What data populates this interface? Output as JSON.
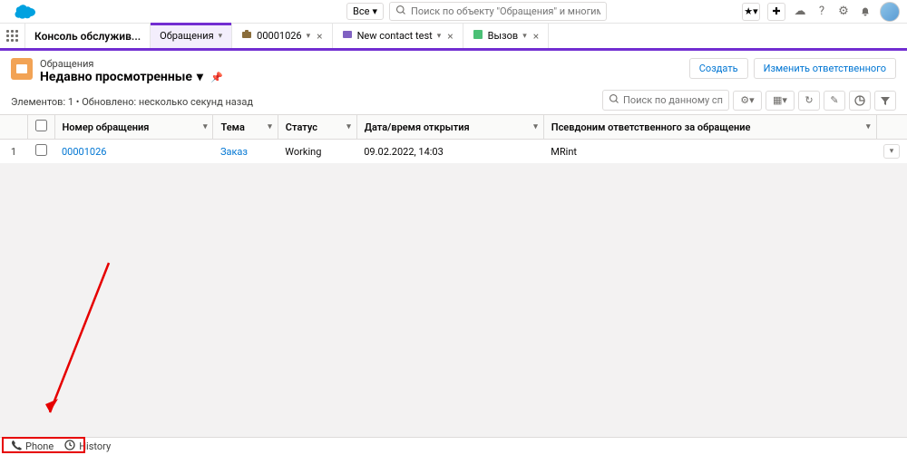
{
  "search": {
    "scope": "Все",
    "placeholder": "Поиск по объекту \"Обращения\" и многим другим..."
  },
  "app": {
    "name": "Консоль обслужив..."
  },
  "tabs": [
    {
      "label": "Обращения",
      "icon": "nav"
    },
    {
      "label": "00001026",
      "icon": "case"
    },
    {
      "label": "New contact test",
      "icon": "contact"
    },
    {
      "label": "Вызов",
      "icon": "task"
    }
  ],
  "page": {
    "objectLabel": "Обращения",
    "listView": "Недавно просмотренные",
    "meta": "Элементов: 1 • Обновлено: несколько секунд назад",
    "listSearchPlaceholder": "Поиск по данному списку..."
  },
  "actions": {
    "create": "Создать",
    "changeOwner": "Изменить ответственного"
  },
  "columns": {
    "caseNumber": "Номер обращения",
    "subject": "Тема",
    "status": "Статус",
    "opened": "Дата/время открытия",
    "ownerAlias": "Псевдоним ответственного за обращение"
  },
  "rows": [
    {
      "num": "1",
      "caseNumber": "00001026",
      "subject": "Заказ",
      "status": "Working",
      "opened": "09.02.2022, 14:03",
      "ownerAlias": "MRint"
    }
  ],
  "utility": {
    "phone": "Phone",
    "history": "History"
  }
}
